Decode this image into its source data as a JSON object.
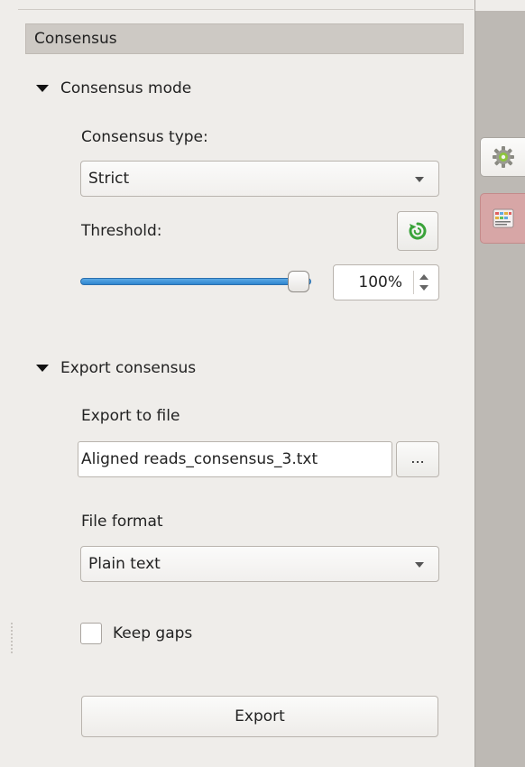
{
  "panel": {
    "header": "Consensus"
  },
  "consensus_mode": {
    "title": "Consensus mode",
    "type_label": "Consensus type:",
    "type_value": "Strict",
    "threshold_label": "Threshold:",
    "threshold_percent": 100,
    "threshold_text": "100%"
  },
  "export": {
    "title": "Export consensus",
    "to_file_label": "Export to file",
    "file_value": "Aligned reads_consensus_3.txt",
    "browse_label": "...",
    "format_label": "File format",
    "format_value": "Plain text",
    "keep_gaps_label": "Keep gaps",
    "keep_gaps_checked": false,
    "export_button": "Export"
  },
  "sidebar": {
    "tabs": [
      {
        "icon": "gear-icon",
        "active": false
      },
      {
        "icon": "consensus-icon",
        "active": true
      }
    ]
  },
  "colors": {
    "slider": "#3a8fd6",
    "active_tab": "#d7a6a6",
    "reset_icon": "#3aa33a"
  }
}
